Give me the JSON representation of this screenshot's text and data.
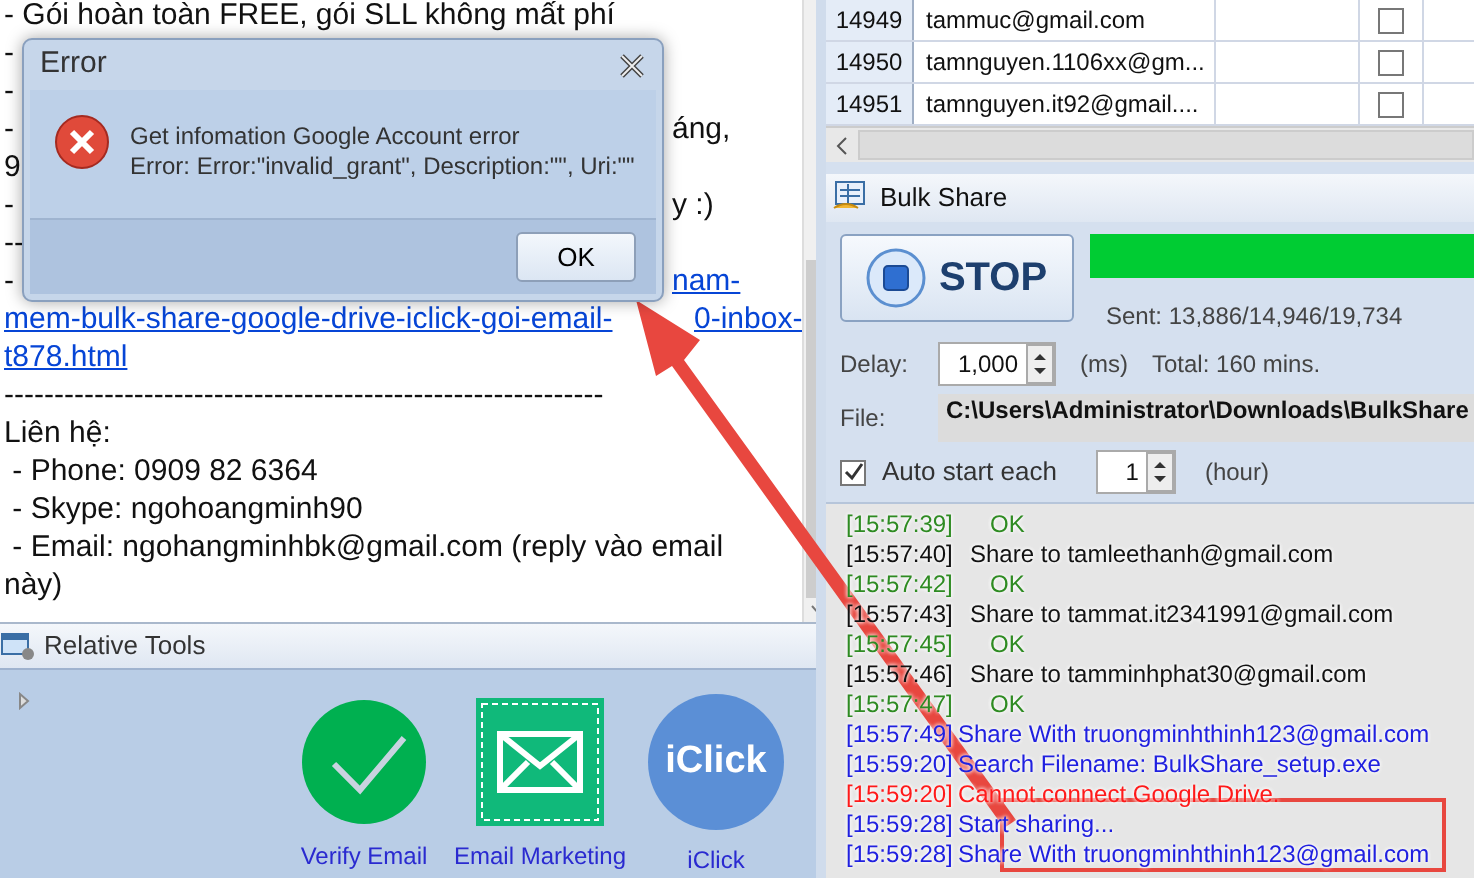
{
  "notes": {
    "lines": [
      {
        "text": "- Gói hoàn toàn FREE, gói SLL không mất phí"
      },
      {
        "text": "-"
      },
      {
        "text": "-"
      },
      {
        "text": "-",
        "tail": {
          "kind": "text",
          "text": "áng,"
        }
      },
      {
        "text": "9"
      },
      {
        "text": "-",
        "tail": {
          "kind": "text",
          "text": "y :)"
        }
      },
      {
        "text": "--"
      },
      {
        "text": "-",
        "tail": {
          "kind": "link",
          "text": "nam-"
        }
      },
      {
        "text": "mem-bulk-share-google-drive-iclick-goi-email-",
        "kind": "link",
        "tail": {
          "kind": "link",
          "text": "0-inbox-"
        }
      },
      {
        "text": "t878.html",
        "kind": "link"
      },
      {
        "text": "------------------------------------------------------------"
      },
      {
        "text": "Liên hệ:"
      },
      {
        "text": " - Phone: 0909 82 6364"
      },
      {
        "text": " - Skype: ngohoangminh90"
      },
      {
        "text": " - Email: ngohangminhbk@gmail.com (reply vào email"
      },
      {
        "text": "này)"
      }
    ]
  },
  "relative_tools": {
    "title": "Relative Tools",
    "tools": [
      {
        "kind": "verify",
        "label": "Verify Email"
      },
      {
        "kind": "marketing",
        "label": "Email Marketing"
      },
      {
        "kind": "iclick",
        "label": "iClick",
        "logo": "iClick"
      }
    ]
  },
  "accounts": {
    "rows": [
      {
        "number": "14949",
        "email": "tammuc@gmail.com",
        "checked": false
      },
      {
        "number": "14950",
        "email": "tamnguyen.1106xx@gm...",
        "checked": false
      },
      {
        "number": "14951",
        "email": "tamnguyen.it92@gmail....",
        "checked": false
      }
    ]
  },
  "bulk_share": {
    "title": "Bulk Share",
    "stop_button": "STOP",
    "progress": {
      "level": 1
    },
    "sent": "Sent: 13,886/14,946/19,734",
    "delay_label": "Delay:",
    "delay": "1,000",
    "delay_unit": "(ms)",
    "total": "Total: 160 mins.",
    "file_label": "File:",
    "file": "C:\\Users\\Administrator\\Downloads\\BulkShare",
    "auto_start": {
      "label": "Auto start each",
      "checked": true,
      "value": "1",
      "unit": "(hour)"
    }
  },
  "log": [
    {
      "time": "[15:57:39]",
      "message": "OK",
      "kind": "result",
      "color": "#2e8b22"
    },
    {
      "time": "[15:57:40]",
      "message": "Share to tamleethanh@gmail.com",
      "kind": "share",
      "color": "#111111"
    },
    {
      "time": "[15:57:42]",
      "message": "OK",
      "kind": "result",
      "color": "#2e8b22"
    },
    {
      "time": "[15:57:43]",
      "message": "Share to tammat.it2341991@gmail.com",
      "kind": "share",
      "color": "#111111"
    },
    {
      "time": "[15:57:45]",
      "message": "OK",
      "kind": "result",
      "color": "#2e8b22"
    },
    {
      "time": "[15:57:46]",
      "message": "Share to tamminhphat30@gmail.com",
      "kind": "share",
      "color": "#111111"
    },
    {
      "time": "[15:57:47]",
      "message": "OK",
      "kind": "result",
      "color": "#2e8b22"
    },
    {
      "time": "[15:57:49]",
      "message": "Share With truongminhthinh123@gmail.com",
      "kind": "info",
      "color": "#2020e0"
    },
    {
      "time": "[15:59:20]",
      "message": "Search Filename: BulkShare_setup.exe",
      "kind": "info",
      "color": "#2020e0"
    },
    {
      "time": "[15:59:20]",
      "message": "Cannot connect Google Drive.",
      "kind": "info",
      "color": "#ff1a1a"
    },
    {
      "time": "[15:59:28]",
      "message": "Start sharing...",
      "kind": "info",
      "color": "#2020e0"
    },
    {
      "time": "[15:59:28]",
      "message": "Share With truongminhthinh123@gmail.com",
      "kind": "info",
      "color": "#2020e0"
    }
  ],
  "dialog": {
    "title": "Error",
    "message": [
      "Get infomation Google Account error",
      "Error: Error:\"invalid_grant\", Description:\"\", Uri:\"\""
    ],
    "button": "OK"
  }
}
